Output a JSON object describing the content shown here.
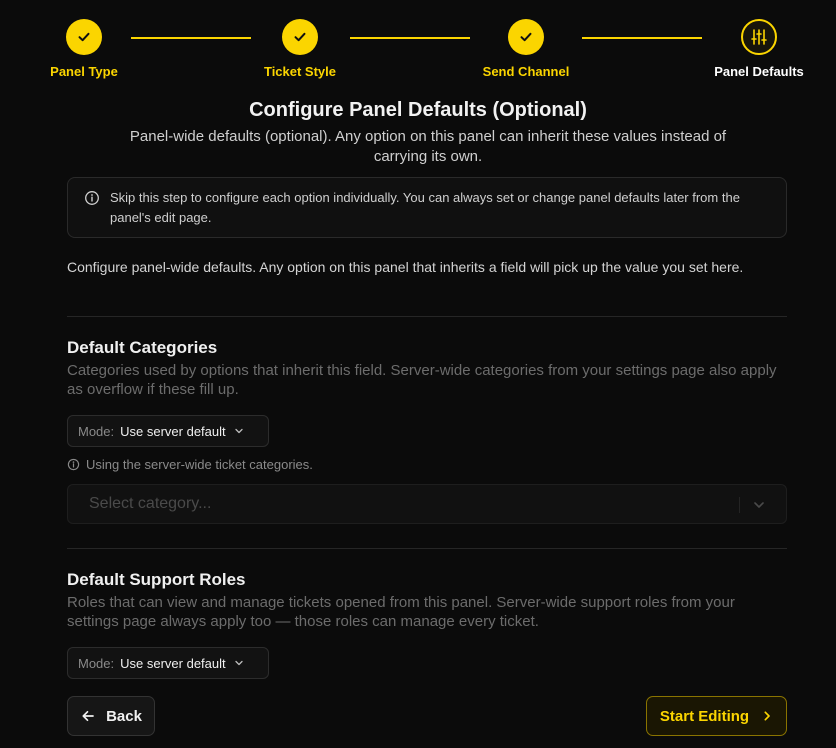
{
  "colors": {
    "accent": "#fbd500",
    "background": "#0b0b0b"
  },
  "stepper": {
    "steps": [
      {
        "label": "Panel Type",
        "state": "completed",
        "icon": "check-icon"
      },
      {
        "label": "Ticket Style",
        "state": "completed",
        "icon": "check-icon"
      },
      {
        "label": "Send Channel",
        "state": "completed",
        "icon": "check-icon"
      },
      {
        "label": "Panel Defaults",
        "state": "current",
        "icon": "sliders-icon"
      }
    ]
  },
  "header": {
    "title": "Configure Panel Defaults (Optional)",
    "subtitle": "Panel-wide defaults (optional). Any option on this panel can inherit these values instead of carrying its own."
  },
  "info": {
    "icon": "info-icon",
    "text": "Skip this step to configure each option individually. You can always set or change panel defaults later from the panel's edit page."
  },
  "intro": "Configure panel-wide defaults. Any option on this panel that inherits a field will pick up the value you set here.",
  "categories": {
    "title": "Default Categories",
    "description": "Categories used by options that inherit this field. Server-wide categories from your settings page also apply as overflow if these fill up.",
    "mode_label": "Mode:",
    "mode_value": "Use server default",
    "hint": "Using the server-wide ticket categories.",
    "select_placeholder": "Select category..."
  },
  "support_roles": {
    "title": "Default Support Roles",
    "description": "Roles that can view and manage tickets opened from this panel. Server-wide support roles from your settings page always apply too — those roles can manage every ticket.",
    "mode_label": "Mode:",
    "mode_value": "Use server default"
  },
  "footer": {
    "back_label": "Back",
    "start_label": "Start Editing"
  }
}
